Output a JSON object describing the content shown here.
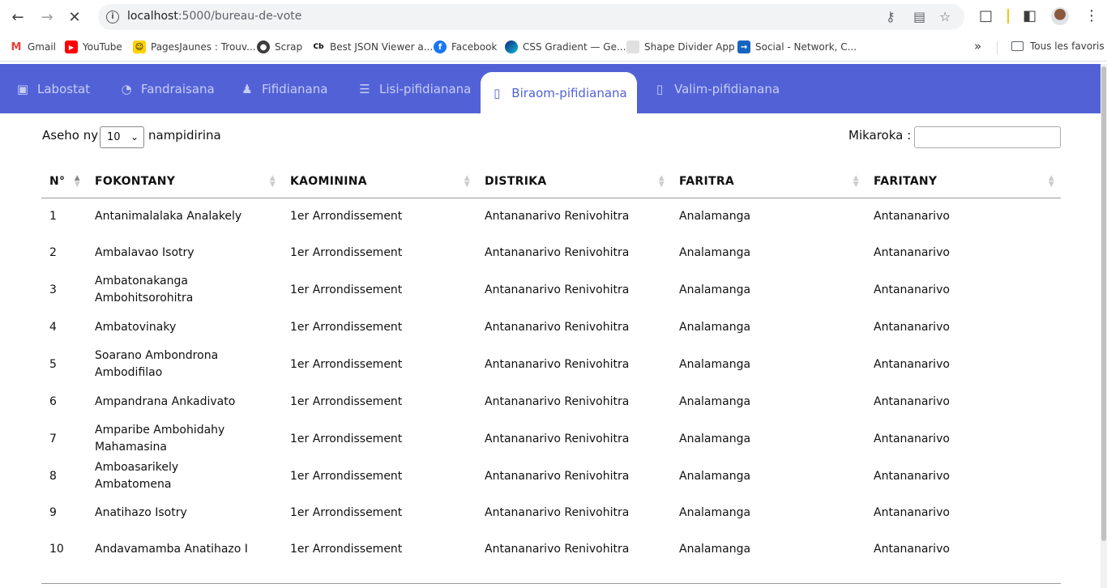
{
  "browser": {
    "url_host": "localhost",
    "url_path": ":5000/bureau-de-vote",
    "bookmarks": [
      {
        "label": "Gmail",
        "icon": "gmail-icon",
        "color": "#ea4335"
      },
      {
        "label": "YouTube",
        "icon": "youtube-icon",
        "color": "#ff0000"
      },
      {
        "label": "PagesJaunes : Trouv...",
        "icon": "pagesjaunes-icon",
        "color": "#ffd200"
      },
      {
        "label": "Scrap",
        "icon": "globe-icon",
        "color": "#3c3c3c"
      },
      {
        "label": "Best JSON Viewer a...",
        "icon": "cb-icon",
        "color": "#000000"
      },
      {
        "label": "Facebook",
        "icon": "facebook-icon",
        "color": "#1877f2"
      },
      {
        "label": "CSS Gradient — Ge...",
        "icon": "css-gradient-icon",
        "color": "#1a237e"
      },
      {
        "label": "Shape Divider App",
        "icon": "shape-divider-icon",
        "color": "#cfcfcf"
      },
      {
        "label": "Social - Network, C...",
        "icon": "social-icon",
        "color": "#1565c0"
      }
    ],
    "bookmarks_more": "»",
    "all_bookmarks": "Tous les favoris"
  },
  "nav": {
    "tabs": [
      {
        "label": "Labostat",
        "icon": "inbox-icon",
        "active": false
      },
      {
        "label": "Fandraisana",
        "icon": "dashboard-icon",
        "active": false
      },
      {
        "label": "Fifidianana",
        "icon": "user-check-icon",
        "active": false
      },
      {
        "label": "Lisi-pifidianana",
        "icon": "list-icon",
        "active": false
      },
      {
        "label": "Biraom-pifidianana",
        "icon": "box-icon",
        "active": true
      },
      {
        "label": "Valim-pifidianana",
        "icon": "box-icon",
        "active": false
      }
    ]
  },
  "table_controls": {
    "length_pre": "Aseho ny",
    "length_value": "10",
    "length_post": "nampidirina",
    "search_label": "Mikaroka :",
    "search_value": ""
  },
  "table": {
    "headers": [
      "N°",
      "FOKONTANY",
      "KAOMININA",
      "DISTRIKA",
      "FARITRA",
      "FARITANY"
    ],
    "rows": [
      [
        "1",
        "Antanimalalaka Analakely",
        "1er Arrondissement",
        "Antananarivo Renivohitra",
        "Analamanga",
        "Antananarivo"
      ],
      [
        "2",
        "Ambalavao Isotry",
        "1er Arrondissement",
        "Antananarivo Renivohitra",
        "Analamanga",
        "Antananarivo"
      ],
      [
        "3",
        "Ambatonakanga Ambohitsorohitra",
        "1er Arrondissement",
        "Antananarivo Renivohitra",
        "Analamanga",
        "Antananarivo"
      ],
      [
        "4",
        "Ambatovinaky",
        "1er Arrondissement",
        "Antananarivo Renivohitra",
        "Analamanga",
        "Antananarivo"
      ],
      [
        "5",
        "Soarano Ambondrona Ambodifilao",
        "1er Arrondissement",
        "Antananarivo Renivohitra",
        "Analamanga",
        "Antananarivo"
      ],
      [
        "6",
        "Ampandrana Ankadivato",
        "1er Arrondissement",
        "Antananarivo Renivohitra",
        "Analamanga",
        "Antananarivo"
      ],
      [
        "7",
        "Amparibe Ambohidahy Mahamasina",
        "1er Arrondissement",
        "Antananarivo Renivohitra",
        "Analamanga",
        "Antananarivo"
      ],
      [
        "8",
        "Amboasarikely Ambatomena",
        "1er Arrondissement",
        "Antananarivo Renivohitra",
        "Analamanga",
        "Antananarivo"
      ],
      [
        "9",
        "Anatihazo Isotry",
        "1er Arrondissement",
        "Antananarivo Renivohitra",
        "Analamanga",
        "Antananarivo"
      ],
      [
        "10",
        "Andavamamba Anatihazo I",
        "1er Arrondissement",
        "Antananarivo Renivohitra",
        "Analamanga",
        "Antananarivo"
      ]
    ]
  },
  "colors": {
    "nav_bg": "#5262d6",
    "nav_text": "#c8cdf4",
    "active_tab_text": "#5262d6"
  }
}
